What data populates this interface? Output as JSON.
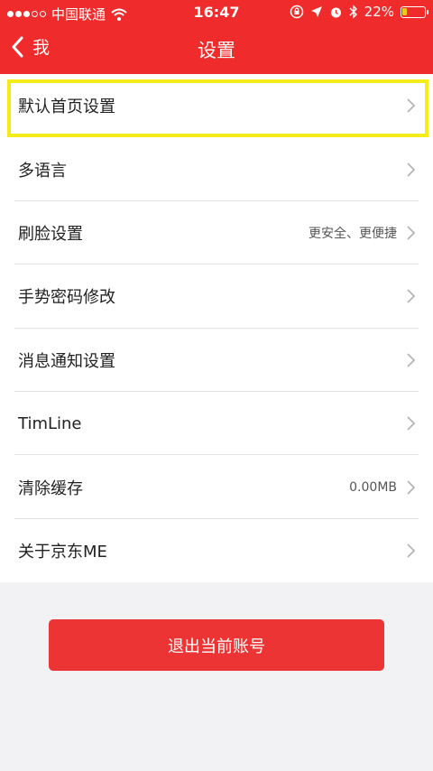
{
  "status_bar": {
    "carrier": "中国联通",
    "time": "16:47",
    "battery_percent": "22%",
    "battery_level": 0.22,
    "signal_dots_filled": 3,
    "signal_dots_total": 5
  },
  "nav": {
    "back_label": "我",
    "title": "设置"
  },
  "settings": [
    {
      "label": "默认首页设置",
      "value": ""
    },
    {
      "label": "多语言",
      "value": ""
    },
    {
      "label": "刷脸设置",
      "value": "更安全、更便捷"
    },
    {
      "label": "手势密码修改",
      "value": ""
    },
    {
      "label": "消息通知设置",
      "value": ""
    },
    {
      "label": "TimLine",
      "value": ""
    },
    {
      "label": "清除缓存",
      "value": "0.00MB"
    },
    {
      "label": "关于京东ME",
      "value": ""
    }
  ],
  "logout_label": "退出当前账号",
  "colors": {
    "header": "#f02b2b",
    "logout_button": "#ec3434",
    "highlight_border": "#f4ec1a",
    "battery_fill": "#f5c518"
  },
  "icons": [
    "signal-dots-icon",
    "wifi-icon",
    "lock-rotation-icon",
    "location-arrow-icon",
    "alarm-icon",
    "bluetooth-icon",
    "battery-icon",
    "back-chevron-icon",
    "chevron-right-icon"
  ]
}
